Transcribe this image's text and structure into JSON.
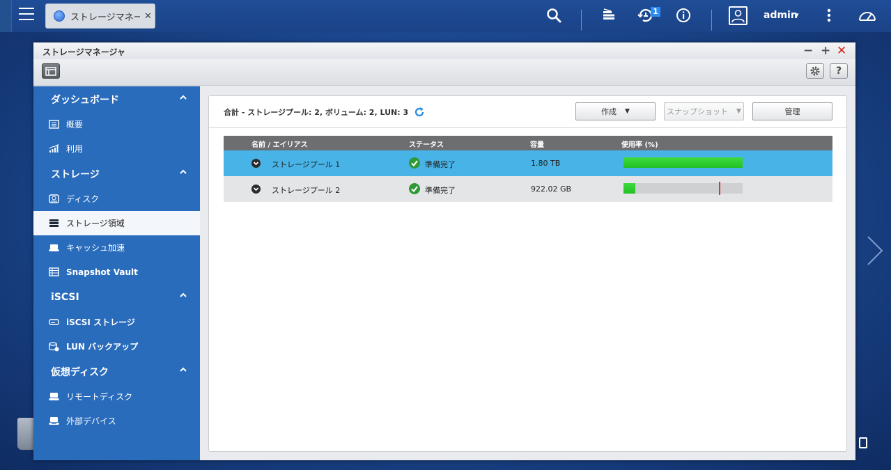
{
  "topbar": {
    "tab_label": "ストレージマネー...",
    "tab_close": "✕",
    "notification_count": "1",
    "user": "admin",
    "user_caret": "▾",
    "icons": [
      "menu-icon",
      "storage-app-icon",
      "search-icon",
      "stack-icon",
      "notification-icon",
      "info-icon",
      "user-icon",
      "more-icon",
      "dashboard-gauge-icon"
    ]
  },
  "window": {
    "title": "ストレージマネージャ",
    "controls": {
      "minimize": "−",
      "maximize": "+",
      "close": "✕"
    },
    "toolbar": {
      "settings_icon": "gear-icon",
      "help_label": "?"
    }
  },
  "sidebar": {
    "sections": [
      {
        "title": "ダッシュボード",
        "items": [
          {
            "label": "概要",
            "icon": "overview-icon"
          },
          {
            "label": "利用",
            "icon": "usage-chart-icon"
          }
        ]
      },
      {
        "title": "ストレージ",
        "items": [
          {
            "label": "ディスク",
            "icon": "disk-icon"
          },
          {
            "label": "ストレージ領域",
            "icon": "storage-space-icon",
            "active": true
          },
          {
            "label": "キャッシュ加速",
            "icon": "cache-icon"
          },
          {
            "label": "Snapshot Vault",
            "icon": "snapshot-vault-icon"
          }
        ]
      },
      {
        "title": "iSCSI",
        "items": [
          {
            "label": "iSCSI ストレージ",
            "icon": "iscsi-storage-icon"
          },
          {
            "label": "LUN バックアップ",
            "icon": "lun-backup-icon"
          }
        ]
      },
      {
        "title": "仮想ディスク",
        "items": [
          {
            "label": "リモートディスク",
            "icon": "remote-disk-icon"
          },
          {
            "label": "外部デバイス",
            "icon": "external-device-icon"
          }
        ]
      }
    ]
  },
  "main": {
    "summary": "合計 - ストレージプール: 2, ボリューム: 2, LUN: 3",
    "buttons": {
      "create": "作成",
      "snapshot": "スナップショット",
      "manage": "管理",
      "caret": "▼"
    },
    "table": {
      "columns": [
        "名前 / エイリアス",
        "ステータス",
        "容量",
        "使用率 (%)"
      ],
      "rows": [
        {
          "name": "ストレージプール 1",
          "status": "準備完了",
          "capacity": "1.80 TB",
          "usage": 1.0,
          "threshold": null,
          "selected": true
        },
        {
          "name": "ストレージプール 2",
          "status": "準備完了",
          "capacity": "922.02 GB",
          "usage": 0.1,
          "threshold": 0.8,
          "selected": false
        }
      ]
    }
  },
  "colors": {
    "topbar": "#1f4d97",
    "sidebar": "#2a6cbc",
    "selected_row": "#47b3e6",
    "usage_fill": "#21c021",
    "threshold_marker": "#e0342d",
    "status_ok": "#2f9a35"
  }
}
